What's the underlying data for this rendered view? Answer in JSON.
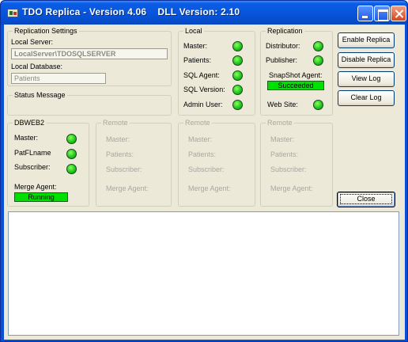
{
  "window": {
    "title": "TDO Replica - Version 4.06    DLL Version: 2.10"
  },
  "replication_settings": {
    "legend": "Replication Settings",
    "local_server_label": "Local Server:",
    "local_server_value": "LocalServer\\TDOSQLSERVER",
    "local_database_label": "Local Database:",
    "local_database_value": "Patients"
  },
  "status_message": {
    "legend": "Status Message"
  },
  "local": {
    "legend": "Local",
    "items": [
      {
        "label": "Master:"
      },
      {
        "label": "Patients:"
      },
      {
        "label": "SQL Agent:"
      },
      {
        "label": "SQL Version:"
      },
      {
        "label": "Admin User:"
      }
    ]
  },
  "replication": {
    "legend": "Replication",
    "distributor_label": "Distributor:",
    "publisher_label": "Publisher:",
    "snapshot_label": "SnapShot Agent:",
    "snapshot_status": "Succeeded",
    "website_label": "Web Site:"
  },
  "dbweb2": {
    "legend": "DBWEB2",
    "master_label": "Master:",
    "patflname_label": "PatFLname",
    "subscriber_label": "Subscriber:",
    "merge_label": "Merge Agent:",
    "merge_status": "Running"
  },
  "remote_groups": [
    {
      "legend": "Remote",
      "master": "Master:",
      "patients": "Patients:",
      "subscriber": "Subscriber:",
      "merge": "Merge Agent:"
    },
    {
      "legend": "Remote",
      "master": "Master:",
      "patients": "Patients:",
      "subscriber": "Subscriber:",
      "merge": "Merge Agent:"
    },
    {
      "legend": "Remote",
      "master": "Master:",
      "patients": "Patients:",
      "subscriber": "Subscriber:",
      "merge": "Merge Agent:"
    }
  ],
  "buttons": {
    "enable_replica": "Enable Replica",
    "disable_replica": "Disable Replica",
    "view_log": "View Log",
    "clear_log": "Clear Log",
    "close": "Close"
  },
  "colors": {
    "status_ok": "#00e000",
    "titlebar": "#0754d9",
    "dialog_bg": "#ece9d8"
  }
}
